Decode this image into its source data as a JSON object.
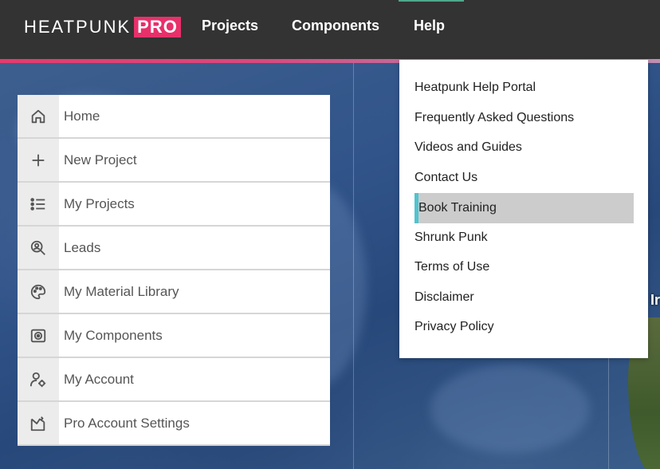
{
  "header": {
    "logo_word": "HEATPUNK",
    "logo_pro": "PRO",
    "nav": [
      {
        "label": "Projects"
      },
      {
        "label": "Components"
      },
      {
        "label": "Help"
      }
    ]
  },
  "sidebar": {
    "items": [
      {
        "label": "Home",
        "icon": "home-icon"
      },
      {
        "label": "New Project",
        "icon": "plus-icon"
      },
      {
        "label": "My Projects",
        "icon": "list-icon"
      },
      {
        "label": "Leads",
        "icon": "search-person-icon"
      },
      {
        "label": "My Material Library",
        "icon": "palette-icon"
      },
      {
        "label": "My Components",
        "icon": "component-icon"
      },
      {
        "label": "My Account",
        "icon": "user-settings-icon"
      },
      {
        "label": "Pro Account Settings",
        "icon": "pro-settings-icon"
      }
    ]
  },
  "help_menu": {
    "items": [
      {
        "label": "Heatpunk Help Portal"
      },
      {
        "label": "Frequently Asked Questions"
      },
      {
        "label": "Videos and Guides"
      },
      {
        "label": "Contact Us"
      },
      {
        "label": "Book Training",
        "highlighted": true
      },
      {
        "label": "Shrunk Punk"
      },
      {
        "label": "Terms of Use"
      },
      {
        "label": "Disclaimer"
      },
      {
        "label": "Privacy Policy"
      }
    ]
  },
  "map": {
    "land_label": "Ir"
  },
  "colors": {
    "header_bg": "#333333",
    "brand_pink": "#e8306b",
    "highlight_bar": "#4fc4d0",
    "highlight_bg": "#cccccc"
  }
}
